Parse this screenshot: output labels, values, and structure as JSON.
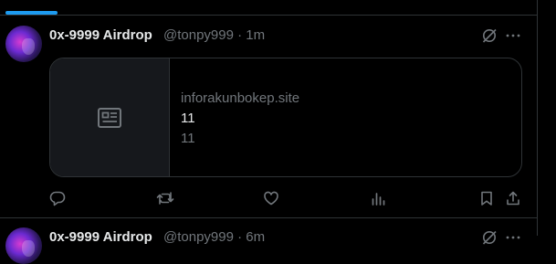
{
  "tweet1": {
    "display_name": "0x-9999 Airdrop",
    "handle_time": "@tonpy999 · 1m",
    "card": {
      "domain": "inforakunbokep.site",
      "title": "11",
      "description": "11"
    }
  },
  "tweet2": {
    "display_name": "0x-9999 Airdrop",
    "handle_time": "@tonpy999 · 6m"
  },
  "icons": {
    "grok": "grok-icon",
    "more": "more-icon",
    "card_placeholder": "article-icon",
    "reply": "reply-icon",
    "retweet": "retweet-icon",
    "like": "like-icon",
    "views": "views-icon",
    "bookmark": "bookmark-icon",
    "share": "share-icon"
  },
  "colors": {
    "background": "#000000",
    "accent": "#1d9bf0",
    "text_primary": "#e7e9ea",
    "text_secondary": "#71767b",
    "border": "#2f3336"
  }
}
